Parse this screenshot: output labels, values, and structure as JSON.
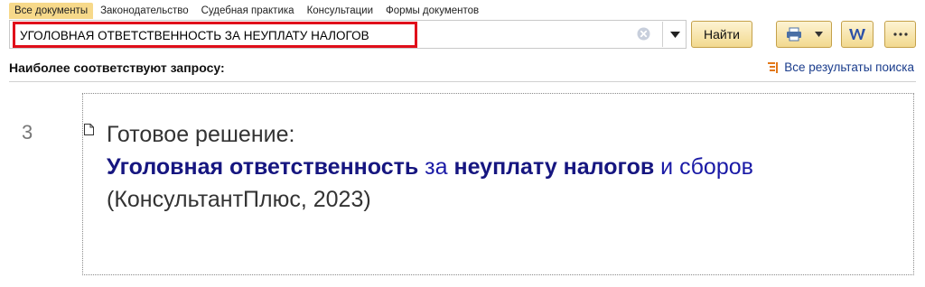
{
  "tabs": [
    {
      "label": "Все документы",
      "active": true
    },
    {
      "label": "Законодательство",
      "active": false
    },
    {
      "label": "Судебная практика",
      "active": false
    },
    {
      "label": "Консультации",
      "active": false
    },
    {
      "label": "Формы документов",
      "active": false
    }
  ],
  "search": {
    "value": "УГОЛОВНАЯ ОТВЕТСТВЕННОСТЬ ЗА НЕУПЛАТУ НАЛОГОВ",
    "find_label": "Найти"
  },
  "results_header": {
    "title": "Наиболее соответствуют запросу:",
    "all_results_label": "Все результаты поиска"
  },
  "result": {
    "rank": "3",
    "prefix": "Готовое решение:",
    "title_parts": [
      {
        "text": "Уголовная ответственность",
        "bold": true
      },
      {
        "text": " за ",
        "bold": false
      },
      {
        "text": "неуплату налогов",
        "bold": true
      },
      {
        "text": " и сборов",
        "bold": false
      }
    ],
    "source": "(КонсультантПлюс, 2023)"
  },
  "colors": {
    "accent_tab": "#f7d98a",
    "highlight_border": "#e00e1a",
    "link": "#1a1aa6"
  }
}
